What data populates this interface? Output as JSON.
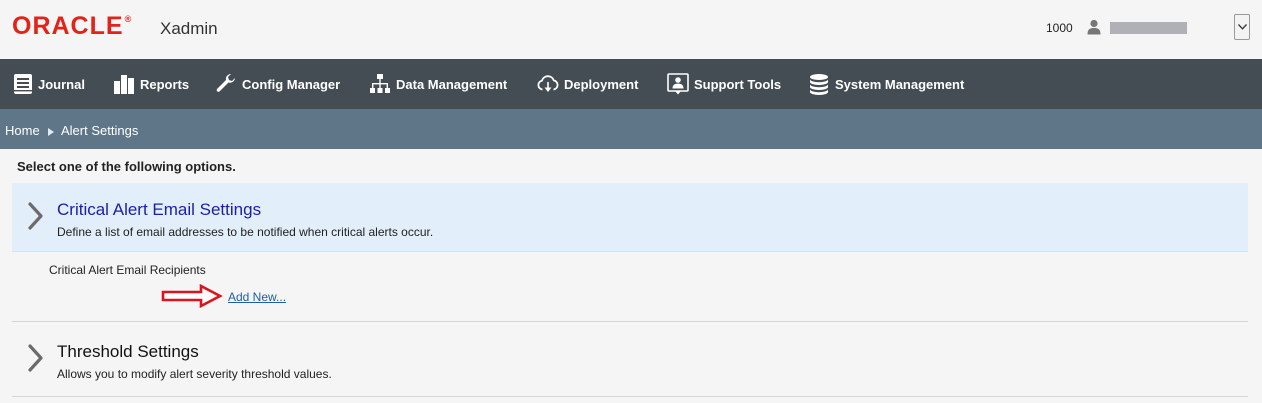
{
  "header": {
    "logo_text": "ORACLE",
    "logo_mark": "®",
    "app_name": "Xadmin",
    "user_id": "1000",
    "user_icon": "user-icon",
    "menu_icon": "chevron-down-icon"
  },
  "nav": {
    "items": [
      {
        "label": "Journal",
        "icon": "journal-icon"
      },
      {
        "label": "Reports",
        "icon": "reports-icon"
      },
      {
        "label": "Config Manager",
        "icon": "wrench-icon"
      },
      {
        "label": "Data Management",
        "icon": "hierarchy-icon"
      },
      {
        "label": "Deployment",
        "icon": "cloud-download-icon"
      },
      {
        "label": "Support Tools",
        "icon": "support-icon"
      },
      {
        "label": "System Management",
        "icon": "database-icon"
      }
    ]
  },
  "breadcrumb": {
    "home": "Home",
    "separator": "▶",
    "current": "Alert Settings"
  },
  "main": {
    "instructions": "Select one of the following options.",
    "critical": {
      "title": "Critical Alert Email Settings",
      "description": "Define a list of email addresses to be notified when critical alerts occur.",
      "recipients_label": "Critical Alert Email Recipients",
      "add_new": "Add New..."
    },
    "threshold": {
      "title": "Threshold Settings",
      "description": "Allows you to modify alert severity threshold values."
    }
  },
  "colors": {
    "brand_red": "#e2231a",
    "nav_bg": "#444d53",
    "breadcrumb_bg": "#5f7689",
    "section_highlight": "#e2eef9",
    "link": "#1f5ea8",
    "critical_title": "#1a1fa8",
    "annotation_arrow": "#d9141e"
  }
}
